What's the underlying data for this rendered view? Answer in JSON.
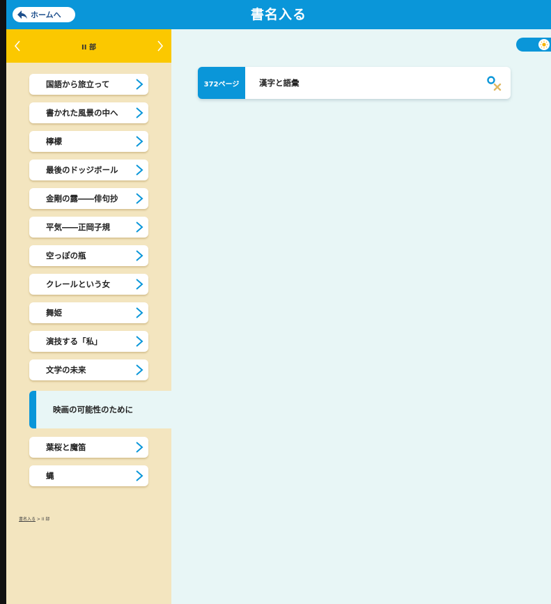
{
  "header": {
    "home_label": "ホームへ",
    "title": "書名入る"
  },
  "sidebar": {
    "part_label": "II 部",
    "items": [
      {
        "label": "国語から旅立って"
      },
      {
        "label": "書かれた風景の中へ"
      },
      {
        "label": "檸檬"
      },
      {
        "label": "最後のドッジボール"
      },
      {
        "label": "金剛の露――俳句抄"
      },
      {
        "label": "平気――正岡子規"
      },
      {
        "label": "空っぽの瓶"
      },
      {
        "label": "クレールという女"
      },
      {
        "label": "舞姫"
      },
      {
        "label": "演技する「私」"
      },
      {
        "label": "文学の未来"
      },
      {
        "label": "映画の可能性のために"
      },
      {
        "label": "葉桜と魔笛"
      },
      {
        "label": "蝿"
      }
    ],
    "active_index": 11,
    "breadcrumb": {
      "root": "書名入る",
      "separator": " > ",
      "current": "II 部"
    }
  },
  "main": {
    "results": [
      {
        "page": "372ページ",
        "title": "漢字と語彙"
      }
    ]
  },
  "colors": {
    "accent": "#0a96d9",
    "part_bar": "#fbc800",
    "sidebar_bg": "#f3e5bf",
    "main_bg": "#e8f6f6"
  },
  "icons": {
    "home": "back-arrow-icon",
    "item": "chevron-right-icon",
    "toggle": "sun-icon",
    "result_action": "clear-search-icon"
  }
}
